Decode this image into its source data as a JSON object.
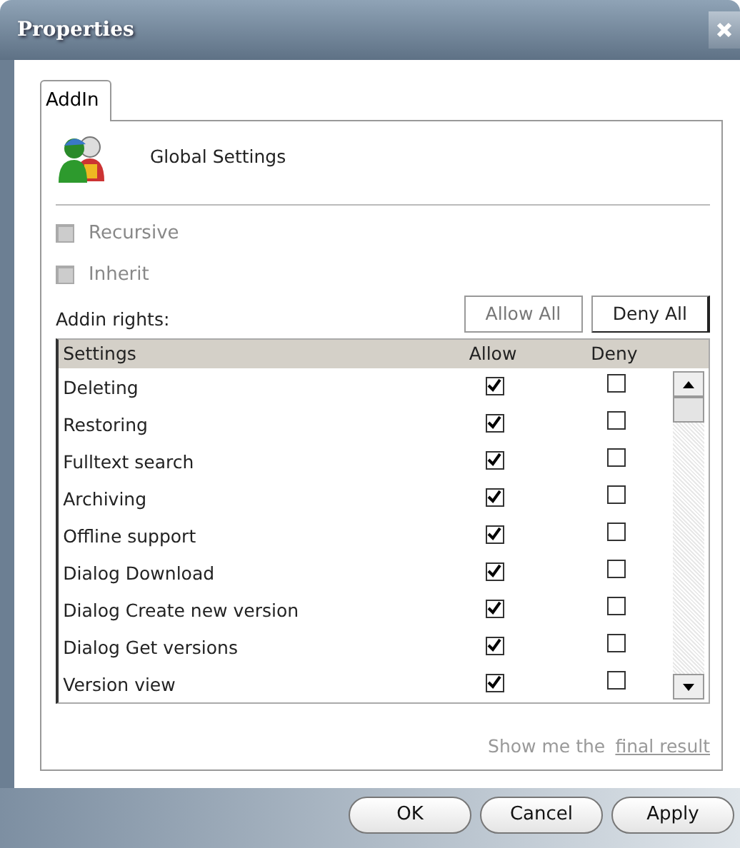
{
  "window": {
    "title": "Properties"
  },
  "tabs": [
    {
      "label": "AddIn",
      "selected": true
    }
  ],
  "header": {
    "title": "Global Settings"
  },
  "options": [
    {
      "label": "Recursive",
      "checked": false,
      "disabled": true
    },
    {
      "label": "Inherit",
      "checked": false,
      "disabled": true
    }
  ],
  "rights": {
    "label": "Addin rights:",
    "buttons": [
      {
        "label": "Allow All",
        "disabled": true
      },
      {
        "label": "Deny All",
        "disabled": false
      }
    ]
  },
  "table": {
    "columns": [
      "Settings",
      "Allow",
      "Deny"
    ],
    "rows": [
      {
        "name": "Deleting",
        "allow": true,
        "deny": false
      },
      {
        "name": "Restoring",
        "allow": true,
        "deny": false
      },
      {
        "name": "Fulltext search",
        "allow": true,
        "deny": false
      },
      {
        "name": "Archiving",
        "allow": true,
        "deny": false
      },
      {
        "name": "Offline support",
        "allow": true,
        "deny": false
      },
      {
        "name": "Dialog Download",
        "allow": true,
        "deny": false
      },
      {
        "name": "Dialog Create new version",
        "allow": true,
        "deny": false
      },
      {
        "name": "Dialog Get versions",
        "allow": true,
        "deny": false
      },
      {
        "name": "Version view",
        "allow": true,
        "deny": false
      }
    ]
  },
  "footer": {
    "text": "Show me the",
    "link": "final result"
  },
  "buttons": [
    "OK",
    "Cancel",
    "Apply"
  ]
}
